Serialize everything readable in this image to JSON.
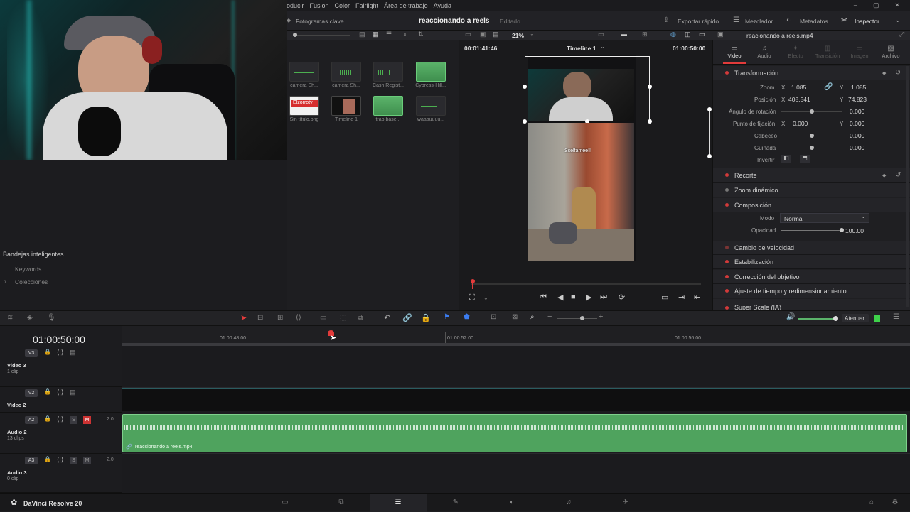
{
  "menu": {
    "items": [
      "oducir",
      "Fusion",
      "Color",
      "Fairlight",
      "Área de trabajo",
      "Ayuda"
    ]
  },
  "topbar": {
    "keyframes_label": "Fotogramas clave",
    "project_title": "reaccionando a reels",
    "project_status": "Editado",
    "quick_export": "Exportar rápido",
    "mixer": "Mezclador",
    "metadata": "Metadatos",
    "inspector": "Inspector"
  },
  "viewer": {
    "zoom": "21%",
    "timecode_left": "00:01:41:46",
    "timeline_name": "Timeline 1",
    "timecode_right": "01:00:50:00",
    "overlay_text": "Scelfamee!!"
  },
  "media_pool": {
    "clips": [
      {
        "label": "camera Sh...",
        "kind": "audio"
      },
      {
        "label": "camera Sh...",
        "kind": "audio"
      },
      {
        "label": "Cash Regist...",
        "kind": "audio"
      },
      {
        "label": "Cypress-Hill...",
        "kind": "audio-green"
      },
      {
        "label": "Sin título.png",
        "kind": "image",
        "badge": "Elzorrotv"
      },
      {
        "label": "Timeline 1",
        "kind": "timeline"
      },
      {
        "label": "trap base...",
        "kind": "audio-green"
      },
      {
        "label": "waaauuuu...",
        "kind": "audio"
      }
    ]
  },
  "left_panel": {
    "smart_bins": "Bandejas inteligentes",
    "keywords": "Keywords",
    "collections": "Colecciones"
  },
  "inspector": {
    "file_name": "reacionando a reels.mp4",
    "tabs": [
      "Video",
      "Audio",
      "Efecto",
      "Transición",
      "Imagen",
      "Archivo"
    ],
    "transform": {
      "title": "Transformación",
      "zoom_label": "Zoom",
      "zoom_x": "1.085",
      "zoom_y": "1.085",
      "position_label": "Posición",
      "pos_x": "408.541",
      "pos_y": "74.823",
      "rotation_label": "Ángulo de rotación",
      "rotation": "0.000",
      "anchor_label": "Punto de fijación",
      "anchor_x": "0.000",
      "anchor_y": "0.000",
      "pitch_label": "Cabeceo",
      "pitch": "0.000",
      "yaw_label": "Guiñada",
      "yaw": "0.000",
      "flip_label": "Invertir"
    },
    "crop": "Recorte",
    "dynamic_zoom": "Zoom dinámico",
    "composite": {
      "title": "Composición",
      "mode_label": "Modo",
      "mode": "Normal",
      "opacity_label": "Opacidad",
      "opacity": "100.00"
    },
    "speed_change": "Cambio de velocidad",
    "stabilization": "Estabilización",
    "lens_correction": "Corrección del objetivo",
    "retime": "Ajuste de tiempo y redimensionamiento",
    "super_scale": "Super Scale (IA)"
  },
  "timeline": {
    "timecode": "01:00:50:00",
    "ruler": [
      "01:00:48:00",
      "01:00:52:00",
      "01:00:56:00"
    ],
    "attenuate": "Atenuar",
    "tracks": [
      {
        "tag": "V3",
        "name": "Video 3",
        "sub": "1 clip"
      },
      {
        "tag": "V2",
        "name": "Video 2",
        "sub": ""
      },
      {
        "tag": "A2",
        "name": "Audio 2",
        "sub": "13 clips",
        "channels": "2.0"
      },
      {
        "tag": "A3",
        "name": "Audio 3",
        "sub": "0 clip",
        "channels": "2.0"
      }
    ],
    "audio_clip_name": "reaccionando a reels.mp4"
  },
  "status": {
    "app_name": "DaVinci Resolve 20"
  },
  "colors": {
    "accent_red": "#e23b3b",
    "audio_green": "#5bb36a",
    "panel": "#1f1f22"
  }
}
